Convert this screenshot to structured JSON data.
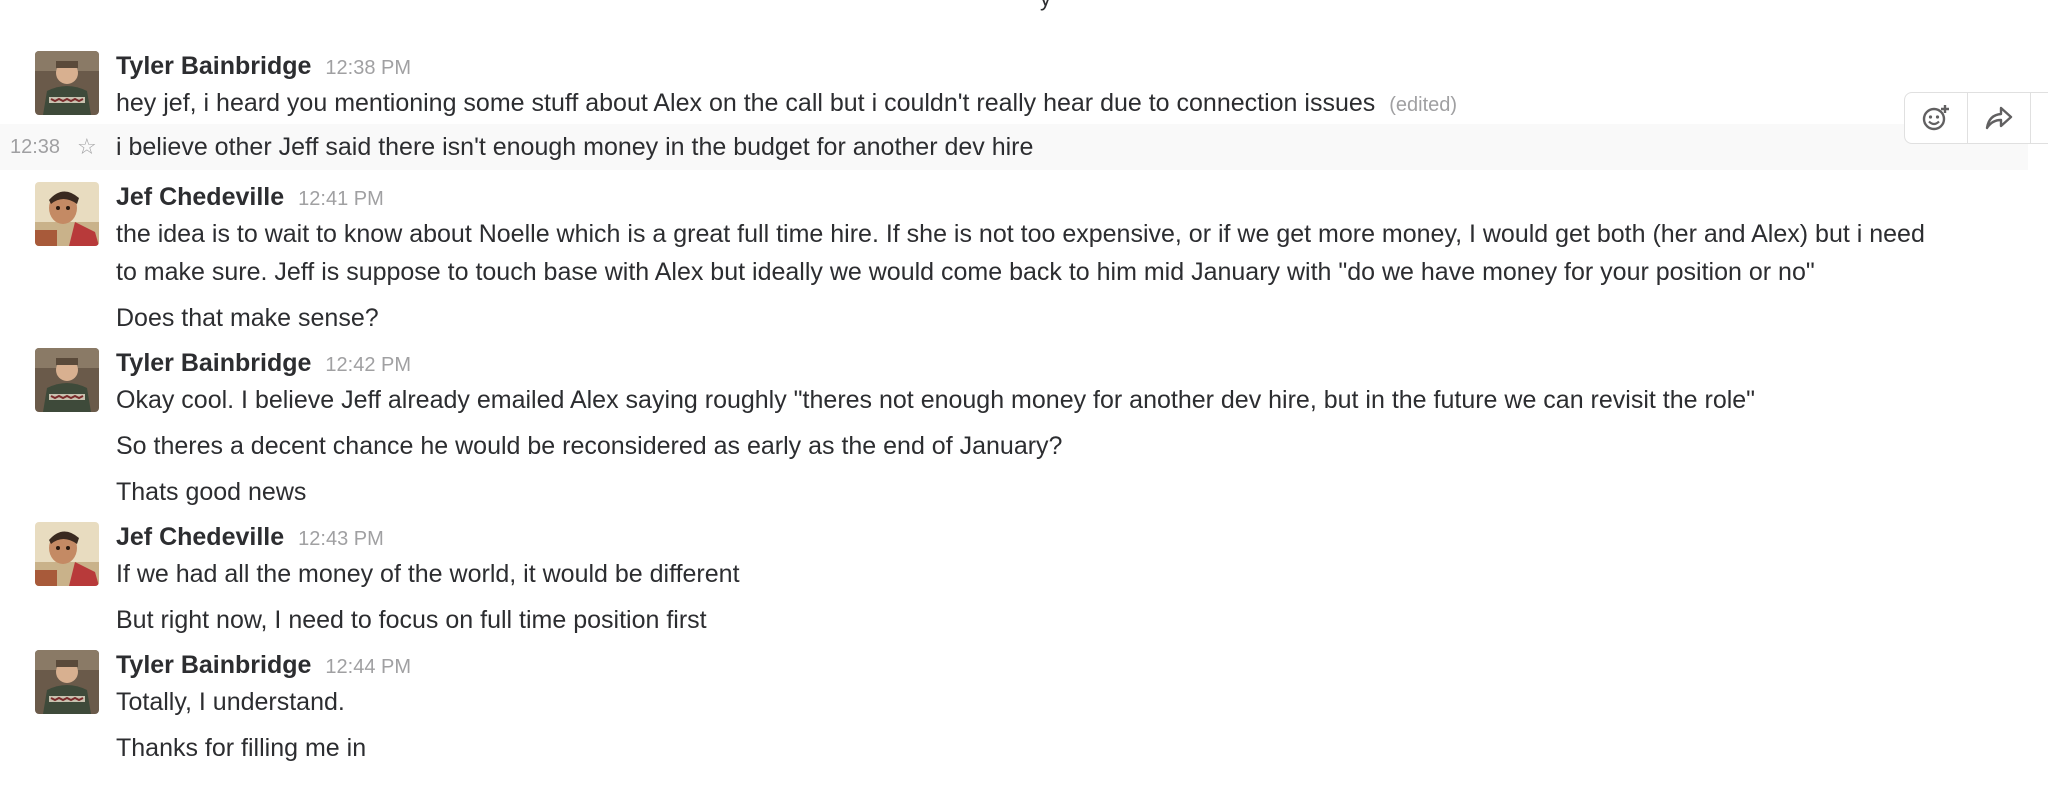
{
  "top_partial_text": "y",
  "actions": {
    "add_reaction_icon": "emoji-add-icon",
    "share_icon": "share-arrow-icon"
  },
  "messages": [
    {
      "author": "Tyler Bainbridge",
      "time": "12:38 PM",
      "lines": [
        "hey jef, i heard you mentioning some stuff about Alex on the call but i couldn't really hear due to connection issues"
      ],
      "edited_label": "(edited)",
      "hover_line": {
        "stamp": "12:38",
        "text": "i believe other Jeff said there isn't enough money in the budget for another dev hire"
      }
    },
    {
      "author": "Jef Chedeville",
      "time": "12:41 PM",
      "lines": [
        "the idea is to wait to know about Noelle which is a great full time hire. If she is not too expensive, or if we get more money, I would get both (her and Alex) but i need",
        "to make sure. Jeff is suppose to touch base with Alex but ideally we would come back to him mid January with \"do we have money for your position or no\"",
        "Does that make sense?"
      ]
    },
    {
      "author": "Tyler Bainbridge",
      "time": "12:42 PM",
      "lines": [
        "Okay cool. I believe Jeff already emailed Alex saying roughly \"theres not enough money for another dev hire, but in the future we can revisit the role\"",
        "So theres a decent chance he would be reconsidered as early as the end of January?",
        "Thats good news"
      ]
    },
    {
      "author": "Jef Chedeville",
      "time": "12:43 PM",
      "lines": [
        "If we had all the money of the world, it would be different",
        "But right now, I need to focus on full time position first"
      ]
    },
    {
      "author": "Tyler Bainbridge",
      "time": "12:44 PM",
      "lines": [
        "Totally, I understand.",
        "Thanks for filling me in"
      ]
    }
  ]
}
